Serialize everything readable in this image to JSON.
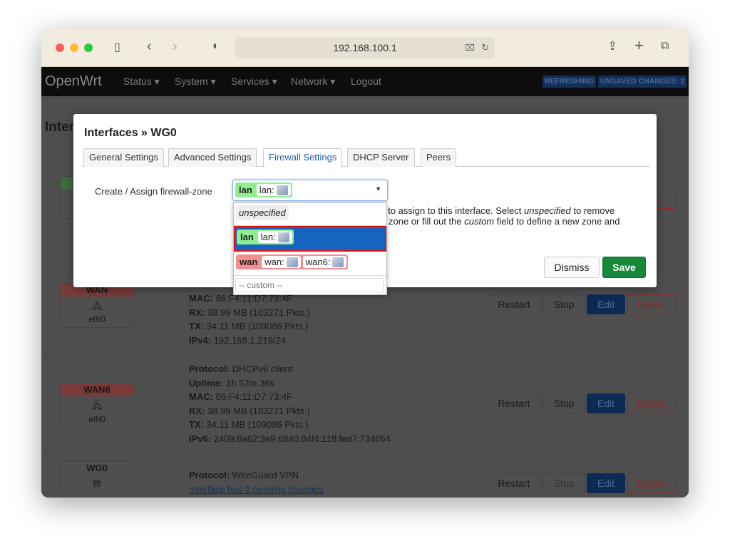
{
  "browser": {
    "url": "192.168.100.1",
    "colors": {
      "close": "#ff5f57",
      "min": "#febc2e",
      "max": "#28c840"
    }
  },
  "nav": {
    "brand": "OpenWrt",
    "items": [
      "Status ▾",
      "System ▾",
      "Services ▾",
      "Network ▾",
      "Logout"
    ],
    "badges": [
      "REFRESHING",
      "UNSAVED CHANGES: 2"
    ]
  },
  "page": {
    "title": "Interfaces",
    "interfaces": [
      {
        "name": "WAN",
        "device": "eth0",
        "color": "#7a3a3a",
        "lines": [
          [
            "MAC:",
            "86:F4:11:D7:73:4F"
          ],
          [
            "RX:",
            "38.99 MB (103271 Pkts.)"
          ],
          [
            "TX:",
            "34.11 MB (109086 Pkts.)"
          ],
          [
            "IPv4:",
            "192.168.1.219/24"
          ]
        ]
      },
      {
        "name": "WAN6",
        "device": "eth0",
        "color": "#7a3a3a",
        "lines": [
          [
            "Protocol:",
            "DHCPv6 client"
          ],
          [
            "Uptime:",
            "1h 57m 36s"
          ],
          [
            "MAC:",
            "86:F4:11:D7:73:4F"
          ],
          [
            "RX:",
            "38.99 MB (103271 Pkts.)"
          ],
          [
            "TX:",
            "34.11 MB (109086 Pkts.)"
          ],
          [
            "IPv6:",
            "2409:8a62:3e9:6840:84f4:11ff:fed7:734f/64"
          ]
        ]
      },
      {
        "name": "WG0",
        "lines": [
          [
            "Protocol:",
            "WireGuard VPN"
          ]
        ],
        "pending": "Interface has 2 pending changes"
      }
    ],
    "buttons": {
      "restart": "Restart",
      "stop": "Stop",
      "edit": "Edit",
      "delete": "Delete"
    }
  },
  "modal": {
    "title": "Interfaces » WG0",
    "tabs": [
      "General Settings",
      "Advanced Settings",
      "Firewall Settings",
      "DHCP Server",
      "Peers"
    ],
    "active_tab": "Firewall Settings",
    "field_label": "Create / Assign firewall-zone",
    "selected": {
      "zone": "lan",
      "devices": [
        "lan:"
      ]
    },
    "help_line1": [
      "t to assign to this interface. Select ",
      "unspecified",
      " to remove"
    ],
    "help_line2": [
      "zone or fill out the ",
      "custom",
      " field to define a new zone and"
    ],
    "options": [
      {
        "label": "unspecified"
      },
      {
        "zone": "lan",
        "devices": [
          "lan:"
        ],
        "color": "#90ee90"
      },
      {
        "zone": "wan",
        "devices": [
          "wan:",
          "wan6:"
        ],
        "color": "#f09090"
      }
    ],
    "custom_placeholder": "-- custom --",
    "dismiss": "Dismiss",
    "save": "Save"
  }
}
